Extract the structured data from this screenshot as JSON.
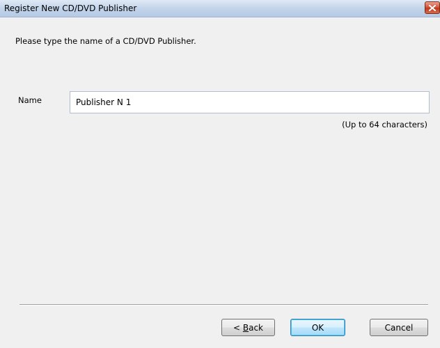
{
  "window": {
    "title": "Register New CD/DVD Publisher",
    "close_icon": "close-icon"
  },
  "content": {
    "prompt": "Please type the name of a CD/DVD Publisher.",
    "name_label": "Name",
    "name_value": "Publisher N 1",
    "char_limit_hint": "(Up to 64 characters)"
  },
  "buttons": {
    "back": {
      "prefix": "< ",
      "accel": "B",
      "rest": "ack"
    },
    "ok": "OK",
    "cancel": "Cancel"
  },
  "colors": {
    "titlebar": "#c3d4ea",
    "dialog_bg": "#f0f0f0",
    "default_button_border": "#3c7fb1",
    "close_button": "#c03a1f"
  }
}
